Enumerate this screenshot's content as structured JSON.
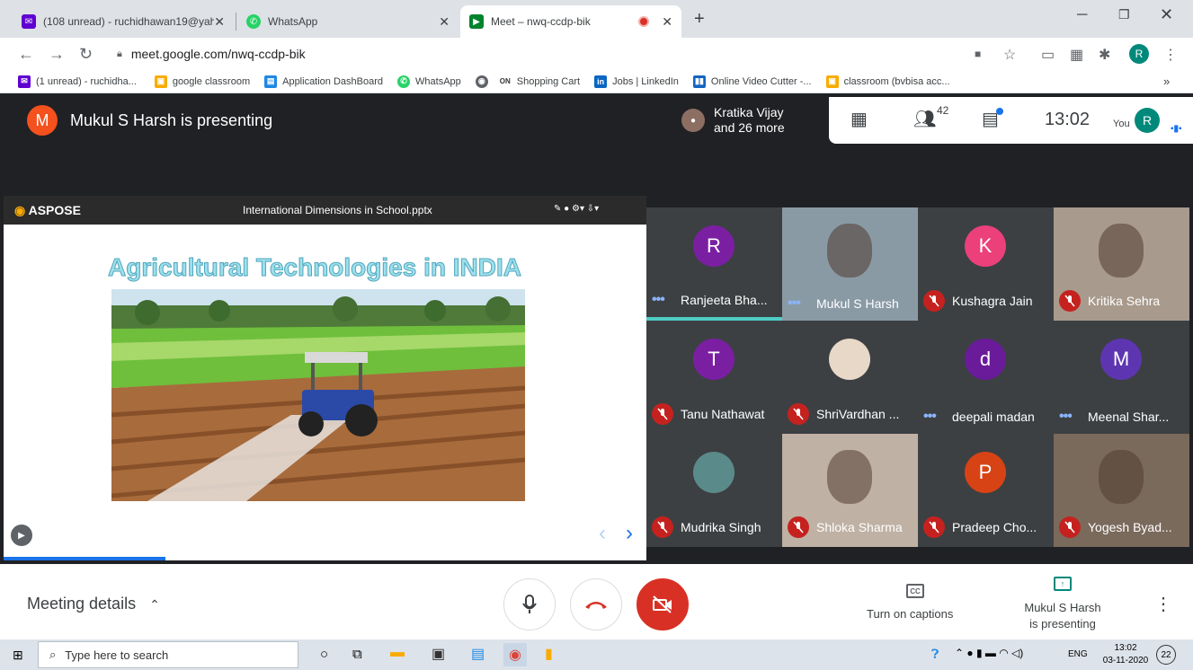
{
  "browser": {
    "tabs": [
      {
        "title": "(108 unread) - ruchidhawan19@yah",
        "close": "✕"
      },
      {
        "title": "WhatsApp",
        "close": "✕"
      },
      {
        "title": "Meet – nwq-ccdp-bik",
        "close": "✕"
      }
    ],
    "new_tab": "+",
    "url": "meet.google.com/nwq-ccdp-bik",
    "profile_initial": "R",
    "bookmarks": [
      "(1 unread) - ruchidha...",
      "google classroom",
      "Application DashBoard",
      "WhatsApp",
      "",
      "Shopping Cart",
      "Jobs | LinkedIn",
      "Online Video Cutter -...",
      "classroom (bvbisa acc..."
    ],
    "bookmarks_more": "»"
  },
  "meet": {
    "presenter_initial": "M",
    "presenter_text": "Mukul S Harsh is presenting",
    "participants_chip": {
      "line1": "Kratika Vijay",
      "line2": "and 26 more"
    },
    "people_count": "42",
    "clock": "13:02",
    "you_label": "You",
    "you_initial": "R",
    "slide": {
      "brand": "ASPOSE",
      "filename": "International Dimensions in School.pptx",
      "title": "Agricultural Technologies in INDIA"
    },
    "tiles": [
      {
        "name": "Ranjeeta Bha...",
        "initial": "R",
        "color": "#7b1fa2",
        "muted": false
      },
      {
        "name": "Mukul S Harsh",
        "initial": "",
        "color": "",
        "muted": false
      },
      {
        "name": "Kushagra Jain",
        "initial": "K",
        "color": "#ec407a",
        "muted": true
      },
      {
        "name": "Kritika Sehra",
        "initial": "",
        "color": "",
        "muted": true
      },
      {
        "name": "Tanu Nathawat",
        "initial": "T",
        "color": "#7b1fa2",
        "muted": true
      },
      {
        "name": "ShriVardhan ...",
        "initial": "",
        "color": "",
        "muted": true
      },
      {
        "name": "deepali madan",
        "initial": "d",
        "color": "#6a1b9a",
        "muted": false
      },
      {
        "name": "Meenal Shar...",
        "initial": "M",
        "color": "#5e35b1",
        "muted": false
      },
      {
        "name": "Mudrika Singh",
        "initial": "",
        "color": "",
        "muted": true
      },
      {
        "name": "Shloka Sharma",
        "initial": "",
        "color": "",
        "muted": true
      },
      {
        "name": "Pradeep Cho...",
        "initial": "P",
        "color": "#d84315",
        "muted": true
      },
      {
        "name": "Yogesh Byad...",
        "initial": "",
        "color": "",
        "muted": true
      }
    ],
    "bottom": {
      "meeting_details": "Meeting details",
      "captions": "Turn on captions",
      "presenting_line1": "Mukul S Harsh",
      "presenting_line2": "is presenting"
    }
  },
  "taskbar": {
    "search_placeholder": "Type here to search",
    "lang": "ENG",
    "time": "13:02",
    "date": "03-11-2020",
    "notif_count": "22"
  }
}
